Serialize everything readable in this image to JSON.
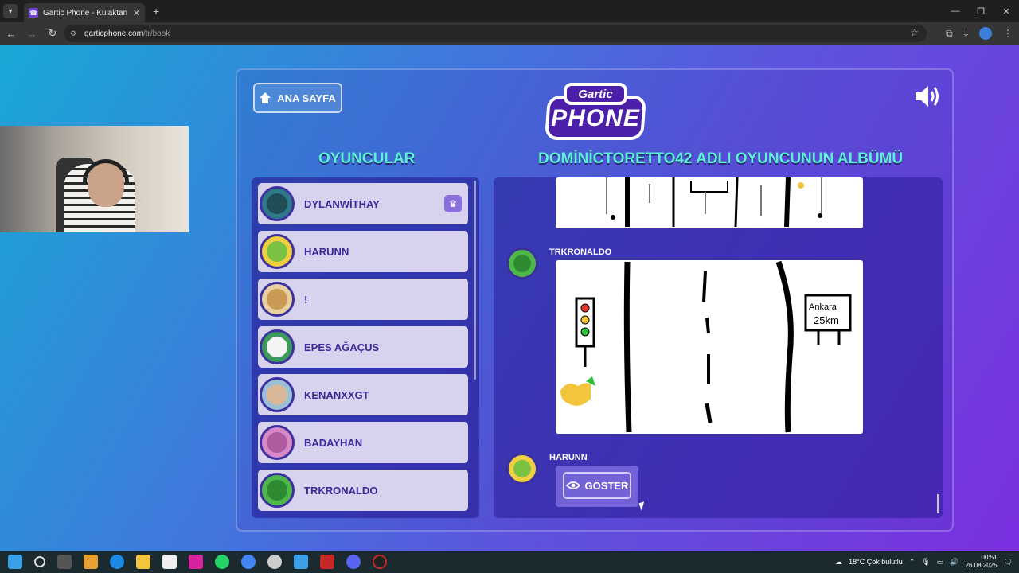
{
  "browser": {
    "tab_title": "Gartic Phone - Kulaktan Kulağa",
    "tab_close": "✕",
    "new_tab": "+",
    "url_host": "garticphone.com",
    "url_path": "/tr/book"
  },
  "game": {
    "home_button": "ANA SAYFA",
    "logo_top": "Gartic",
    "logo_main": "PHONE",
    "players_title": "OYUNCULAR",
    "album_title": "DOMİNİCTORETTO42 ADLI OYUNCUNUN ALBÜMÜ",
    "players": [
      {
        "name": "DYLANWİTHAY",
        "host": true,
        "color": "#2f7a8a"
      },
      {
        "name": "HARUNN",
        "host": false,
        "color": "#7ac143"
      },
      {
        "name": "!",
        "host": false,
        "color": "#c89a55"
      },
      {
        "name": "EPES AĞAÇUS",
        "host": false,
        "color": "#e8e8e8"
      },
      {
        "name": "KENANXXGT",
        "host": false,
        "color": "#9ac0d8"
      },
      {
        "name": "BADAYHAN",
        "host": false,
        "color": "#d889c8"
      },
      {
        "name": "TRKRONALDO",
        "host": false,
        "color": "#4fb84a"
      }
    ],
    "album_entries": [
      {
        "author": "TRKRONALDO",
        "sign_text_1": "Ankara",
        "sign_text_2": "25km"
      },
      {
        "author": "HARUNN",
        "show_button": "GÖSTER"
      }
    ]
  },
  "taskbar": {
    "weather": "18°C Çok bulutlu",
    "time": "00:51",
    "date": "26.08.2025"
  }
}
